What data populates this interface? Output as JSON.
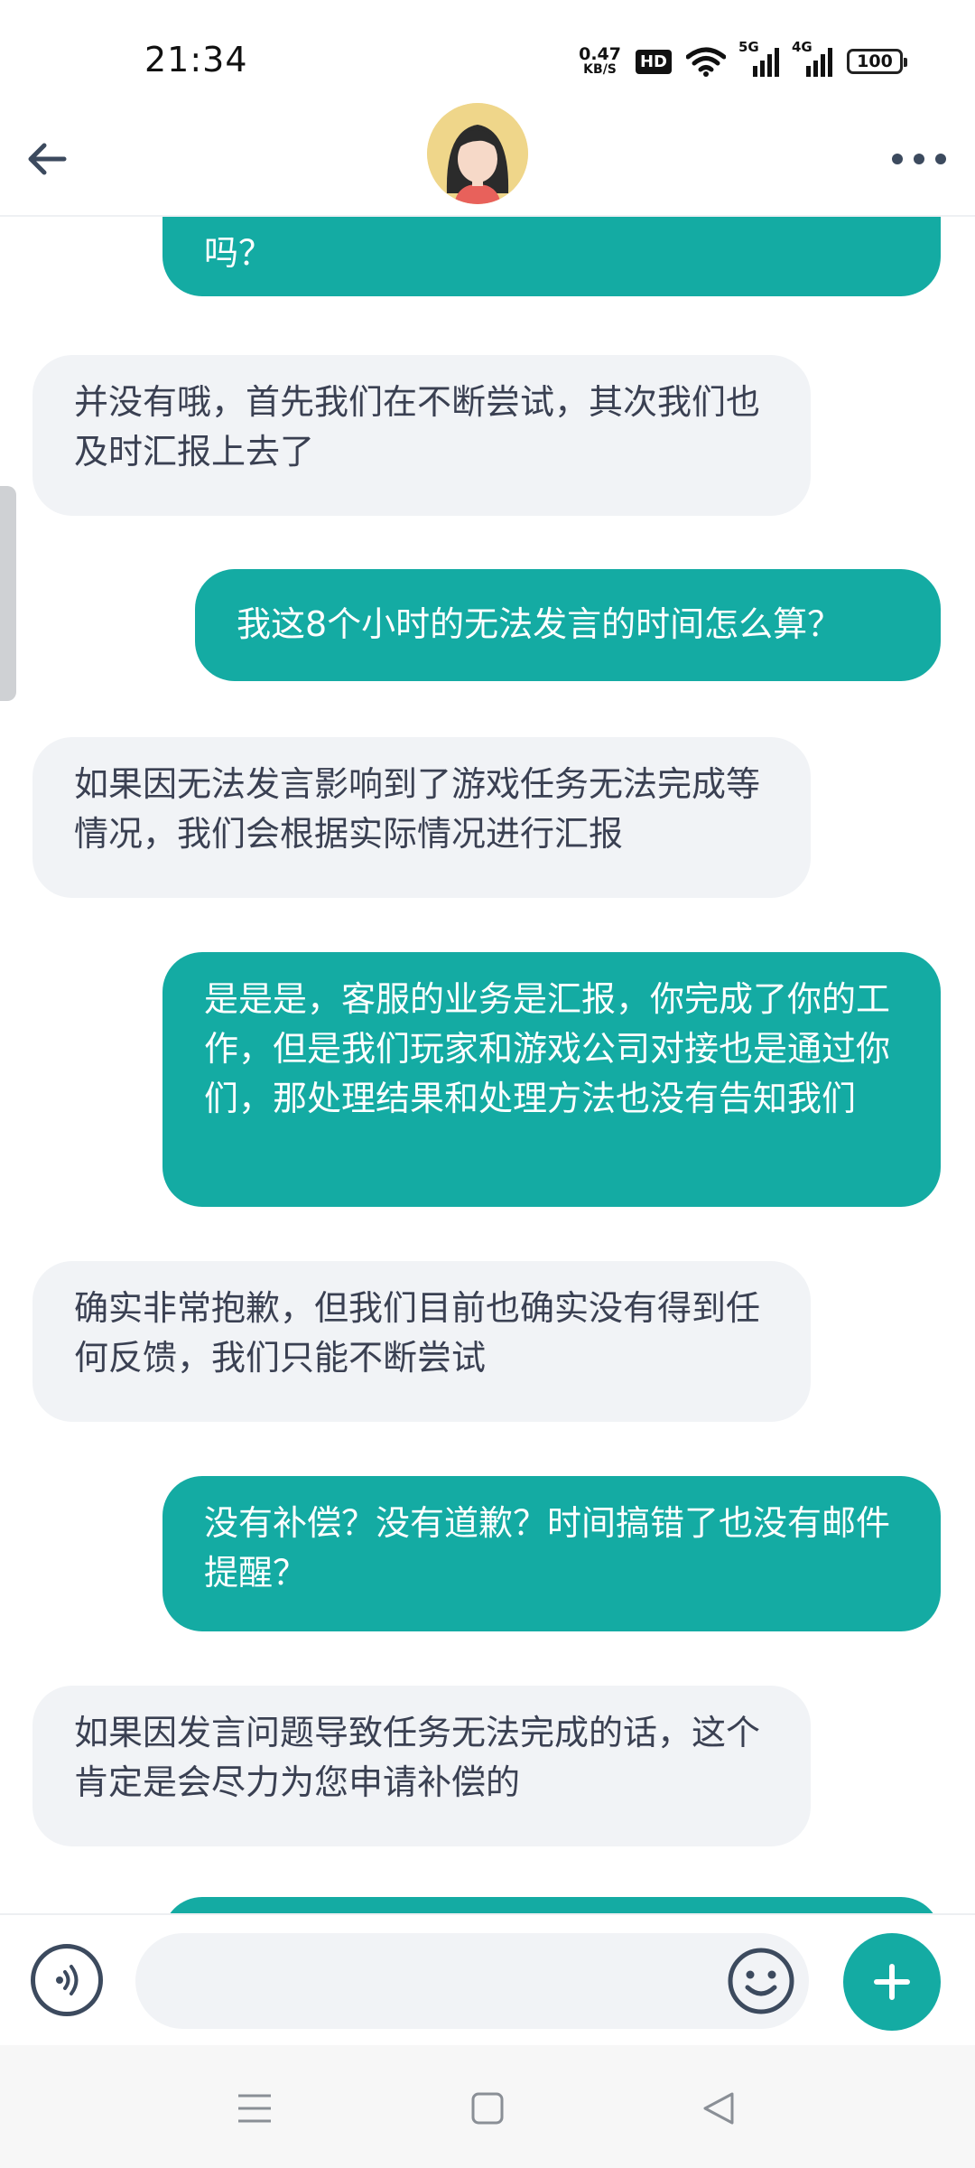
{
  "status_bar": {
    "time": "21:34",
    "net_speed_value": "0.47",
    "net_speed_unit": "KB/S",
    "hd_label": "HD",
    "signal_1_label": "5G",
    "signal_2_label": "4G",
    "battery_level": "100"
  },
  "header": {
    "back_icon": "arrow-left-icon",
    "avatar_icon": "girl-avatar",
    "more_icon": "more-dots-icon"
  },
  "messages": [
    {
      "side": "out",
      "text": "吗？"
    },
    {
      "side": "in",
      "text": "并没有哦，首先我们在不断尝试，其次我们也及时汇报上去了"
    },
    {
      "side": "out",
      "text": "我这8个小时的无法发言的时间怎么算？"
    },
    {
      "side": "in",
      "text": "如果因无法发言影响到了游戏任务无法完成等情况，我们会根据实际情况进行汇报"
    },
    {
      "side": "out",
      "text": "是是是，客服的业务是汇报，你完成了你的工作，但是我们玩家和游戏公司对接也是通过你们，那处理结果和处理方法也没有告知我们"
    },
    {
      "side": "in",
      "text": "确实非常抱歉，但我们目前也确实没有得到任何反馈，我们只能不断尝试"
    },
    {
      "side": "out",
      "text": "没有补偿？没有道歉？时间搞错了也没有邮件提醒？"
    },
    {
      "side": "in",
      "text": "如果因发言问题导致任务无法完成的话，这个肯定是会尽力为您申请补偿的"
    }
  ],
  "input_bar": {
    "voice_icon": "voice-icon",
    "placeholder": "",
    "emoji_icon": "emoji-icon",
    "plus_icon": "plus-icon",
    "accent_color": "#14aba3"
  },
  "nav_bar": {
    "menu_icon": "menu-icon",
    "home_icon": "home-square-icon",
    "back_icon": "back-triangle-icon"
  }
}
